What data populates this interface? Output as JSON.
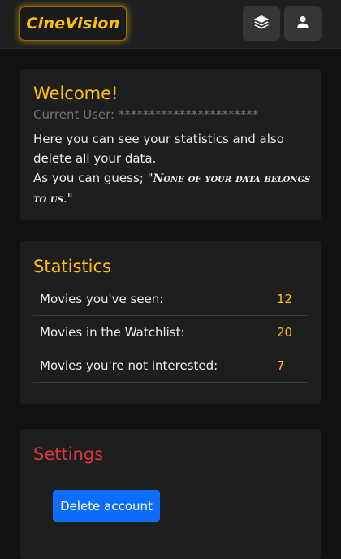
{
  "header": {
    "brand": "CineVision",
    "layers_icon": "layers-icon",
    "user_icon": "user-icon"
  },
  "welcome": {
    "title": "Welcome!",
    "current_user_label": "Current User:",
    "current_user_value": "***********************",
    "intro_line1": "Here you can see your statistics and also delete all your data.",
    "intro_line2_prefix": "As you can guess; \"",
    "quote": "None of your data belongs to us",
    "intro_line2_suffix": ".\""
  },
  "statistics": {
    "title": "Statistics",
    "rows": [
      {
        "label": "Movies you've seen:",
        "value": "12"
      },
      {
        "label": "Movies in the Watchlist:",
        "value": "20"
      },
      {
        "label": "Movies you're not interested:",
        "value": "7"
      }
    ]
  },
  "settings": {
    "title": "Settings",
    "delete_label": "Delete account"
  },
  "colors": {
    "accent": "#ffc107",
    "danger": "#dc3545",
    "primary": "#0d6efd",
    "background": "#121212",
    "card": "#1e1e1e"
  }
}
